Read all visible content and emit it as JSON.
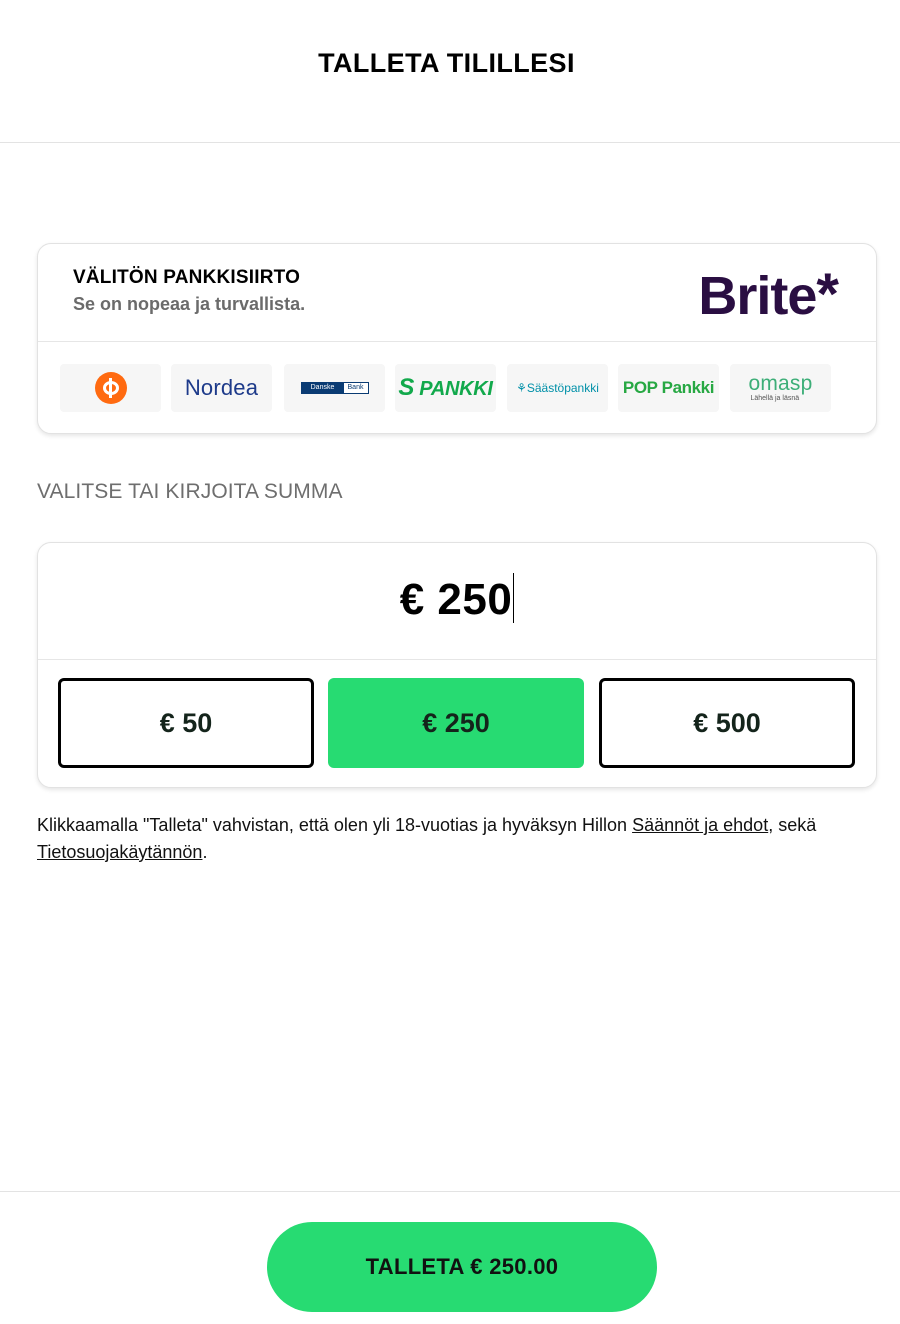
{
  "header": {
    "title": "TALLETA TILILLESI"
  },
  "bank_transfer": {
    "heading": "VÄLITÖN PANKKISIIRTO",
    "subheading": "Se on nopeaa ja turvallista.",
    "provider_logo": "Brite",
    "provider_logo_star": "*",
    "banks": [
      {
        "name": "OP",
        "icon": "op-logo-icon"
      },
      {
        "name": "Nordea"
      },
      {
        "name": "Danske",
        "name2": "Bank"
      },
      {
        "name": "PANKKI"
      },
      {
        "name": "⚘Säästöpankki"
      },
      {
        "name": "POP Pankki"
      },
      {
        "name": "omasp",
        "tagline": "Lähellä ja läsnä"
      }
    ]
  },
  "amount": {
    "label": "VALITSE TAI KIRJOITA SUMMA",
    "current_value": "€ 250",
    "presets": [
      {
        "label": "€ 50",
        "selected": false
      },
      {
        "label": "€ 250",
        "selected": true
      },
      {
        "label": "€ 500",
        "selected": false
      }
    ]
  },
  "terms": {
    "text_before": "Klikkaamalla \"Talleta\" vahvistan, että olen yli 18-vuotias ja hyväksyn Hillon ",
    "rules_link": "Säännöt ja ehdot",
    "text_middle": ", sekä ",
    "privacy_link": "Tietosuojakäytännön",
    "text_after": "."
  },
  "footer": {
    "deposit_button_label": "TALLETA € 250.00"
  },
  "colors": {
    "accent_green": "#27db72",
    "brite_purple": "#2a0e42",
    "op_orange": "#ff6a10",
    "nordea_blue": "#1d3a8a"
  }
}
